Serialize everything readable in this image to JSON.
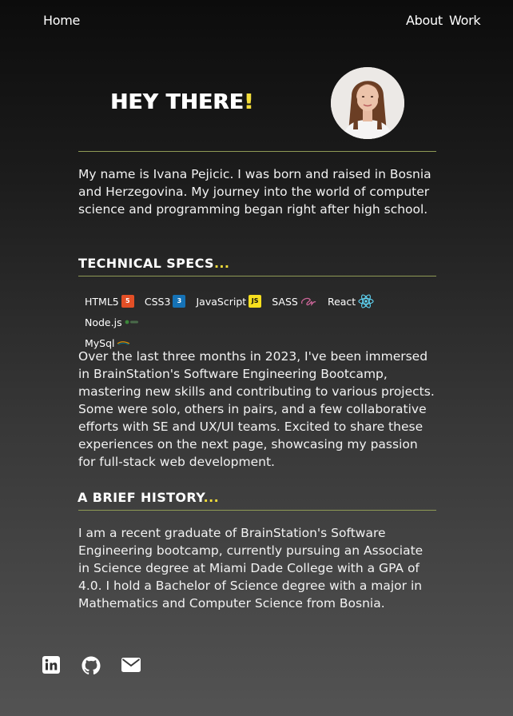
{
  "nav": {
    "home": "Home",
    "about": "About",
    "work": "Work"
  },
  "hero": {
    "title_main": "HEY THERE",
    "title_accent": "!"
  },
  "intro": "My name is Ivana Pejicic. I was born and raised in Bosnia and Herzegovina. My journey into the world of computer science and programming began right after high school.",
  "technical": {
    "title_main": "TECHNICAL SPECS",
    "title_accent": "...",
    "skills": [
      {
        "label": "HTML5",
        "icon": "html5-icon",
        "color": "#e34f26",
        "glyph": "5"
      },
      {
        "label": "CSS3",
        "icon": "css3-icon",
        "color": "#1572b6",
        "glyph": "3"
      },
      {
        "label": "JavaScript",
        "icon": "javascript-icon",
        "color": "#f7df1e",
        "glyph": "JS"
      },
      {
        "label": "SASS",
        "icon": "sass-icon",
        "color": "#cc6699",
        "glyph": ""
      },
      {
        "label": "React",
        "icon": "react-icon",
        "color": "#61dafb",
        "glyph": ""
      },
      {
        "label": "Node.js",
        "icon": "nodejs-icon",
        "color": "#3c873a",
        "glyph": ""
      },
      {
        "label": "MySql",
        "icon": "mysql-icon",
        "color": "#e48e00",
        "glyph": ""
      }
    ],
    "paragraph": "Over the last three months in 2023, I've been immersed in BrainStation's Software Engineering Bootcamp, mastering new skills and contributing to various projects. Some were solo, others in pairs, and a few collaborative efforts with SE and UX/UI teams. Excited to share these experiences on the next page, showcasing my passion for full-stack web development."
  },
  "history": {
    "title_main": "A BRIEF HISTORY",
    "title_accent": "...",
    "paragraph": "I am a recent graduate of BrainStation's Software Engineering bootcamp, currently pursuing an Associate in Science degree at Miami Dade College with a GPA of 4.0. I hold a Bachelor of Science degree with a major in Mathematics and Computer Science from Bosnia."
  },
  "social": [
    "linkedin-icon",
    "github-icon",
    "email-icon"
  ],
  "colors": {
    "accent": "#f3dd3a",
    "rule": "#8f9a55"
  }
}
